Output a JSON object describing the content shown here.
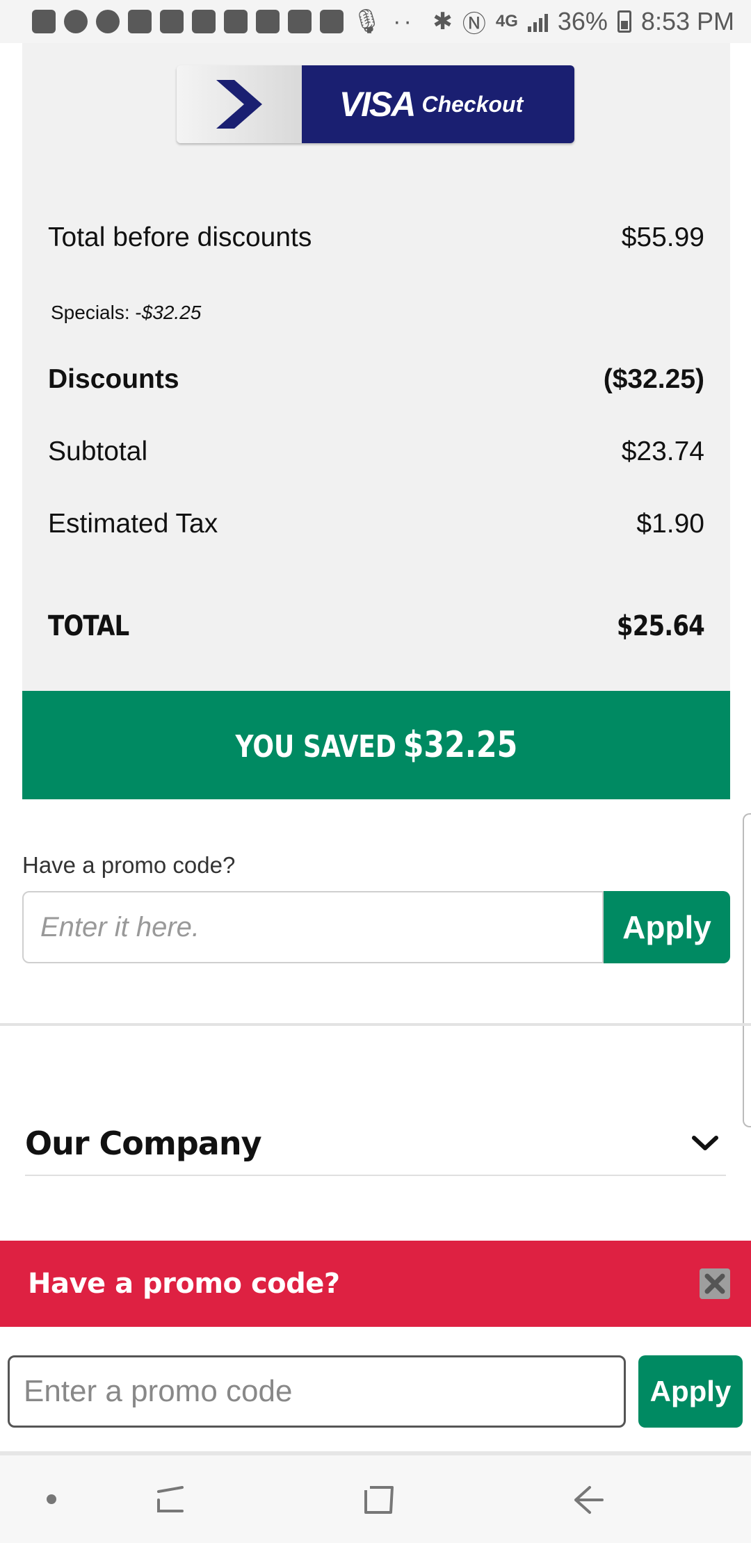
{
  "status_bar": {
    "battery": "36%",
    "time": "8:53 PM",
    "network": "4G"
  },
  "visa_checkout": {
    "brand": "VISA",
    "label": "Checkout"
  },
  "summary": {
    "total_before_discounts_label": "Total before discounts",
    "total_before_discounts_value": "$55.99",
    "specials_label": "Specials: -",
    "specials_value": "$32.25",
    "discounts_label": "Discounts",
    "discounts_value": "($32.25)",
    "subtotal_label": "Subtotal",
    "subtotal_value": "$23.74",
    "tax_label": "Estimated Tax",
    "tax_value": "$1.90",
    "total_label": "TOTAL",
    "total_value": "$25.64"
  },
  "savings": {
    "label": "YOU SAVED",
    "amount": "$32.25"
  },
  "promo": {
    "question": "Have a promo code?",
    "placeholder": "Enter it here.",
    "apply_label": "Apply"
  },
  "footer": {
    "our_company": "Our Company"
  },
  "promo_popup": {
    "title": "Have a promo code?",
    "placeholder": "Enter a promo code",
    "apply_label": "Apply"
  },
  "colors": {
    "brand_green": "#008a62",
    "promo_red": "#de2142",
    "visa_blue": "#1a1f71"
  }
}
